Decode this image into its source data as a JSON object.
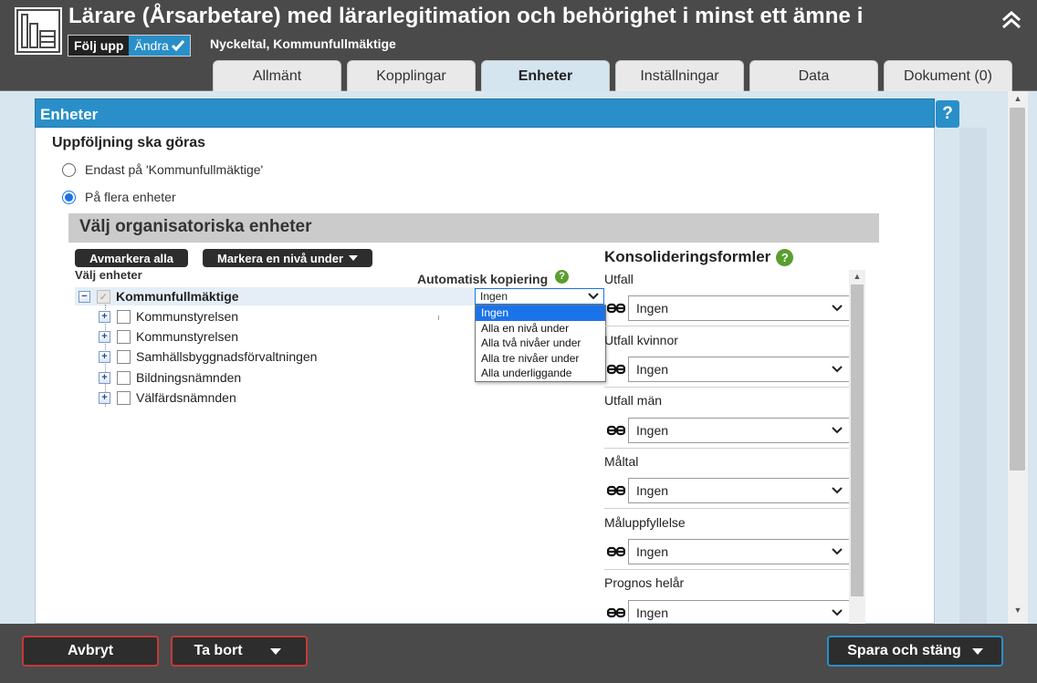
{
  "header": {
    "title": "Lärare (Årsarbetare) med lärarlegitimation och behörighet i minst ett ämne i",
    "subtitle": "Nyckeltal, Kommunfullmäktige",
    "mode_follow": "Följ upp",
    "mode_edit": "Ändra",
    "tabs": [
      {
        "label": "Allmänt",
        "active": false
      },
      {
        "label": "Kopplingar",
        "active": false
      },
      {
        "label": "Enheter",
        "active": true
      },
      {
        "label": "Inställningar",
        "active": false
      },
      {
        "label": "Data",
        "active": false
      },
      {
        "label": "Dokument (0)",
        "active": false
      }
    ]
  },
  "panel": {
    "title": "Enheter",
    "help": "?",
    "section_title": "Uppföljning ska göras",
    "radio_options": [
      {
        "label": "Endast på 'Kommunfullmäktige'",
        "checked": false
      },
      {
        "label": "På flera enheter",
        "checked": true
      }
    ],
    "org_header": "Välj organisatoriska enheter",
    "buttons": {
      "deselect_all": "Avmarkera alla",
      "mark_level_below": "Markera en nivå under"
    },
    "select_units_label": "Välj enheter",
    "auto_copy_label": "Automatisk kopiering",
    "tree": {
      "root": "Kommunfullmäktige",
      "children": [
        "Kommunstyrelsen",
        "Kommunstyrelsen",
        "Samhällsbyggnadsförvaltningen",
        "Bildningsnämnden",
        "Välfärdsnämnden"
      ]
    },
    "copy_select": {
      "value": "Ingen",
      "options": [
        "Ingen",
        "Alla en nivå under",
        "Alla två nivåer under",
        "Alla tre nivåer under",
        "Alla underliggande"
      ]
    },
    "konsolidering": {
      "title": "Konsolideringsformler",
      "rows": [
        {
          "label": "Utfall",
          "value": "Ingen"
        },
        {
          "label": "Utfall kvinnor",
          "value": "Ingen"
        },
        {
          "label": "Utfall män",
          "value": "Ingen"
        },
        {
          "label": "Måltal",
          "value": "Ingen"
        },
        {
          "label": "Måluppfyllelse",
          "value": "Ingen"
        },
        {
          "label": "Prognos helår",
          "value": "Ingen"
        }
      ]
    }
  },
  "footer": {
    "cancel": "Avbryt",
    "delete": "Ta bort",
    "save_close": "Spara och stäng"
  },
  "colors": {
    "accent_blue": "#2a8fc8",
    "header_bg": "#4a4a4a",
    "danger_border": "#c43a3a",
    "help_green": "#5a9e2f"
  }
}
